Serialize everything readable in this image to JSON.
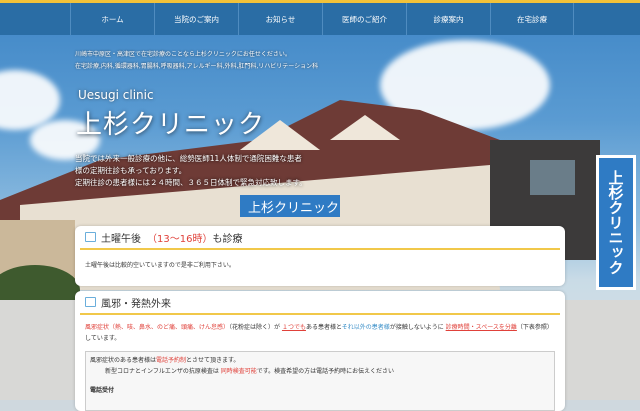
{
  "nav": {
    "items": [
      "ホーム",
      "当院のご案内",
      "お知らせ",
      "医師のご紹介",
      "診療案内",
      "在宅診療"
    ]
  },
  "hero": {
    "intro_line1": "川崎市中原区・高津区で在宅診療のことなら上杉クリニックにお任せください。",
    "intro_line2": "在宅診療,内科,循環器科,胃腸科,呼吸器科,アレルギー科,外科,肛門科,リハビリテーション科",
    "brand_en": "Uesugi clinic",
    "brand_ja": "上杉クリニック",
    "desc_line1": "当院では外来一般診療の他に、総勢医師11人体制で通院困難な患者",
    "desc_line2": "様の定期往診も承っております。",
    "desc_line3": "定期往診の患者様には２４時間、３６５日体制で緊急対応致します。",
    "sign_text": "上杉クリニック",
    "building_sign": "上杉クリニック"
  },
  "card1": {
    "title_a": "土曜午後",
    "title_b": "（13〜16時）",
    "title_c": "も診療",
    "body": "土曜午後は比較的空いていますので是非ご利用下さい。"
  },
  "card2": {
    "title": "風邪・発熱外来",
    "p_a": "風邪症状（熱、咳、鼻水、のど痛、頭痛、けん怠感）",
    "p_b": "（花粉症は除く）が",
    "p_c": "１つでも",
    "p_d": "ある患者様と",
    "p_e": "それ以外の患者様",
    "p_f": "が接触しないように",
    "p_g": "診療時間・スペースを分離",
    "p_h": "（下表参照）しています。",
    "box_a": "風邪症状のある患者様は",
    "box_b": "電話予約制",
    "box_c": "とさせて頂きます。",
    "box2_a": "新型コロナとインフルエンザの抗原検査は",
    "box2_b": "同時検査可能",
    "box2_c": "です。検査希望の方は電話予約時にお伝えください",
    "phone_heading": "電話受付"
  }
}
